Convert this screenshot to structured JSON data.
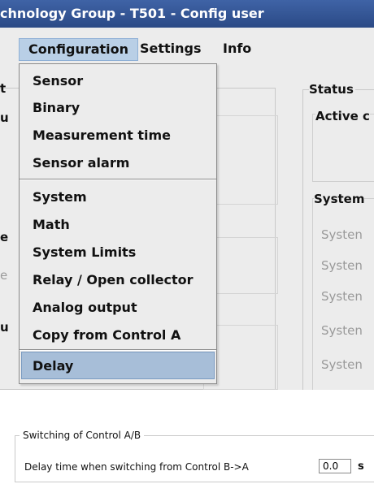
{
  "window": {
    "title": "chnology Group - T501 - Config user"
  },
  "menubar": {
    "items": [
      {
        "label": "Configuration"
      },
      {
        "label": "Settings"
      },
      {
        "label": "Info"
      }
    ]
  },
  "dropdown": {
    "items": [
      "Sensor",
      "Binary",
      "Measurement time",
      "Sensor alarm",
      "System",
      "Math",
      "System Limits",
      "Relay / Open collector",
      "Analog output",
      "Copy from Control A",
      "Delay"
    ],
    "selected": "Delay"
  },
  "background": {
    "left_fragments": [
      "t",
      "u",
      "e",
      "e",
      "u"
    ],
    "status_label": "Status",
    "active_label": "Active c",
    "system_label": "System",
    "system_items": [
      "Systen",
      "Systen",
      "Systen",
      "Systen",
      "Systen"
    ]
  },
  "switching": {
    "legend": "Switching of Control A/B",
    "label": "Delay time when switching from Control B->A",
    "value": "0.0",
    "unit": "s"
  }
}
